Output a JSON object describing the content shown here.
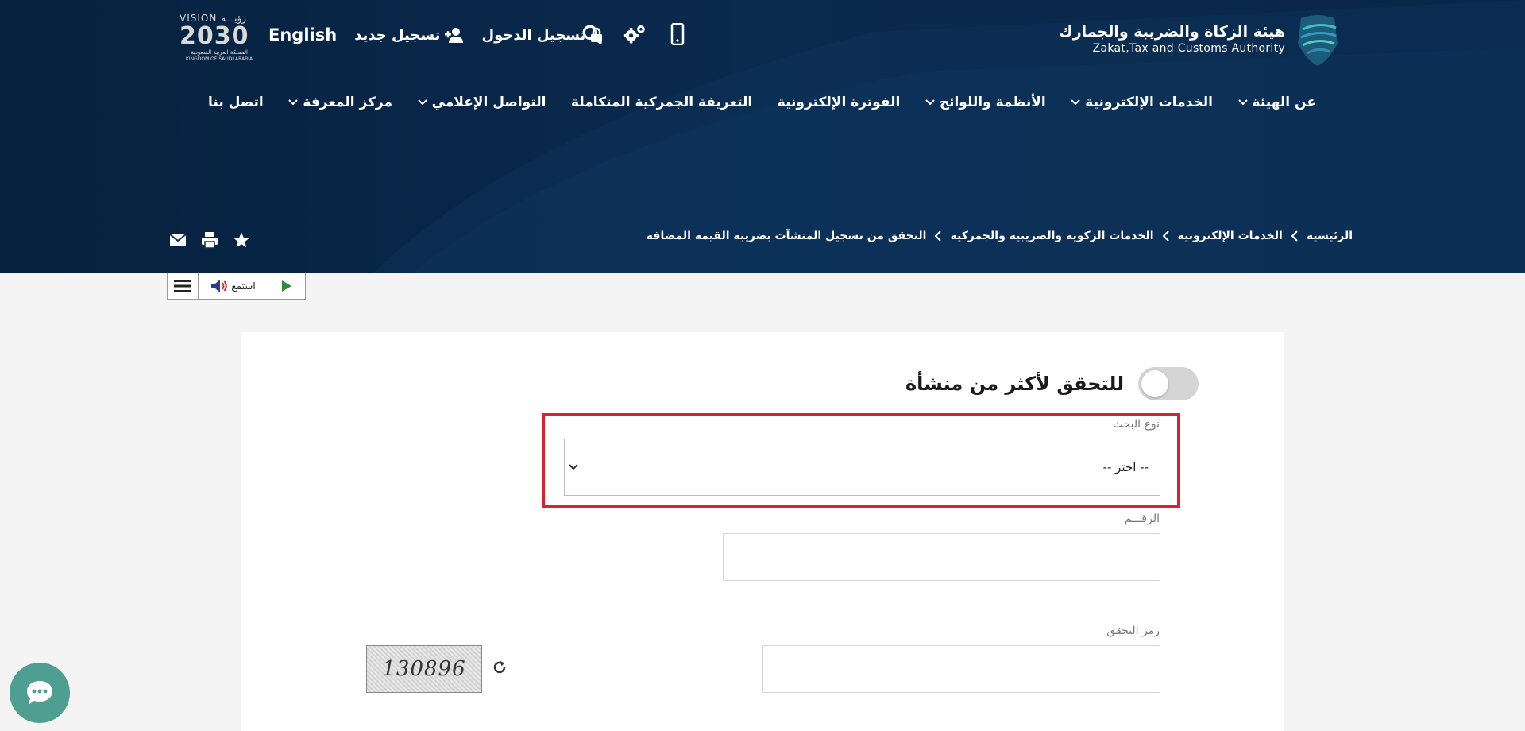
{
  "header": {
    "brand_ar": "هيئة الزكاة والضريبة والجمارك",
    "brand_en": "Zakat,Tax and Customs Authority",
    "vision_line1": "VISION رؤيـــة",
    "vision_year": "2030",
    "vision_line3": "المملكة العربية السعودية",
    "vision_line4": "KINGDOM OF SAUDI ARABIA",
    "login_label": "تسجيل الدخول",
    "register_label": "تسجيل جديد",
    "lang_label": "English"
  },
  "nav": {
    "items": [
      {
        "label": "عن الهيئة",
        "dropdown": true
      },
      {
        "label": "الخدمات الإلكترونية",
        "dropdown": true
      },
      {
        "label": "الأنظمة واللوائح",
        "dropdown": true
      },
      {
        "label": "الفوترة الإلكترونية",
        "dropdown": false
      },
      {
        "label": "التعريفة الجمركية المتكاملة",
        "dropdown": false
      },
      {
        "label": "التواصل الإعلامي",
        "dropdown": true
      },
      {
        "label": "مركز المعرفة",
        "dropdown": true
      },
      {
        "label": "اتصل بنا",
        "dropdown": false
      }
    ]
  },
  "breadcrumb": [
    "الرئيسية",
    "الخدمات الإلكترونية",
    "الخدمات الزكوية والضريبية والجمركية",
    "التحقق من تسجيل المنشآت بضريبة القيمة المضافة"
  ],
  "readspeaker": {
    "listen_label": "استمع"
  },
  "form": {
    "toggle_label": "للتحقق لأكثر من منشأة",
    "toggle_on": false,
    "search_type_label": "نوع البحث",
    "search_type_value": "-- اختر --",
    "number_label": "الرقـــم",
    "number_value": "",
    "captcha_label": "رمز التحقق",
    "captcha_value": "",
    "captcha_code": "130896"
  },
  "colors": {
    "header_bg": "#0a2a4e",
    "highlight": "#d9222d",
    "chat_bg": "#4e9e92"
  }
}
